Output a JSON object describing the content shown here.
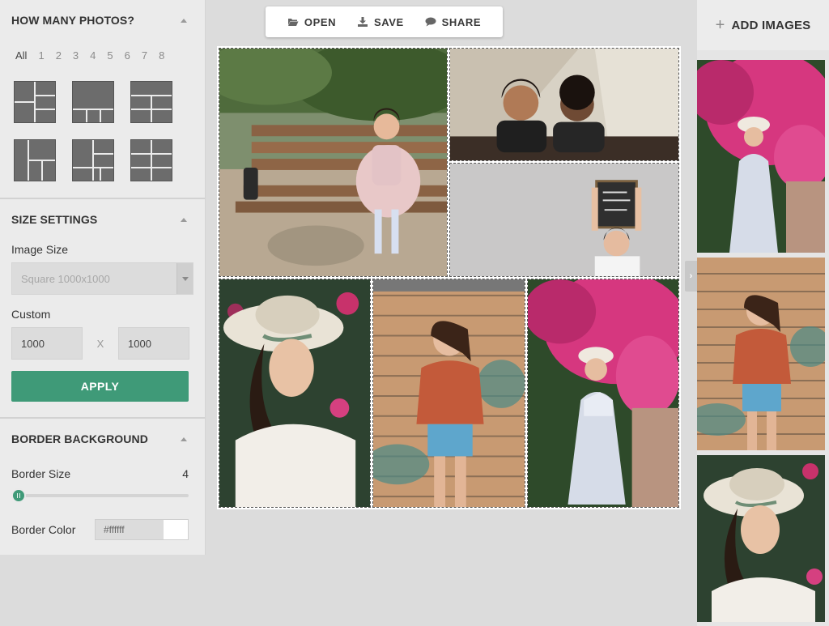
{
  "toolbar": {
    "open_label": "OPEN",
    "save_label": "SAVE",
    "share_label": "SHARE"
  },
  "sections": {
    "photos": {
      "title": "HOW MANY PHOTOS?",
      "counts": [
        "All",
        "1",
        "2",
        "3",
        "4",
        "5",
        "6",
        "7",
        "8"
      ],
      "active_count": "All"
    },
    "size": {
      "title": "SIZE SETTINGS",
      "image_size_label": "Image Size",
      "image_size_value": "Square 1000x1000",
      "custom_label": "Custom",
      "width_value": "1000",
      "x_separator": "X",
      "height_value": "1000",
      "apply_label": "APPLY"
    },
    "border": {
      "title": "BORDER BACKGROUND",
      "border_size_label": "Border Size",
      "border_size_value": "4",
      "border_color_label": "Border Color",
      "border_color_value": "#ffffff"
    }
  },
  "right_panel": {
    "add_images_label": "ADD IMAGES"
  },
  "colors": {
    "accent": "#3f9a78",
    "panel": "#ebebeb",
    "canvas": "#dcdcdc"
  },
  "icons": [
    "folder-open-icon",
    "download-icon",
    "comment-icon",
    "plus-icon",
    "chevron-right-icon",
    "chevron-up-icon",
    "chevron-down-icon"
  ]
}
